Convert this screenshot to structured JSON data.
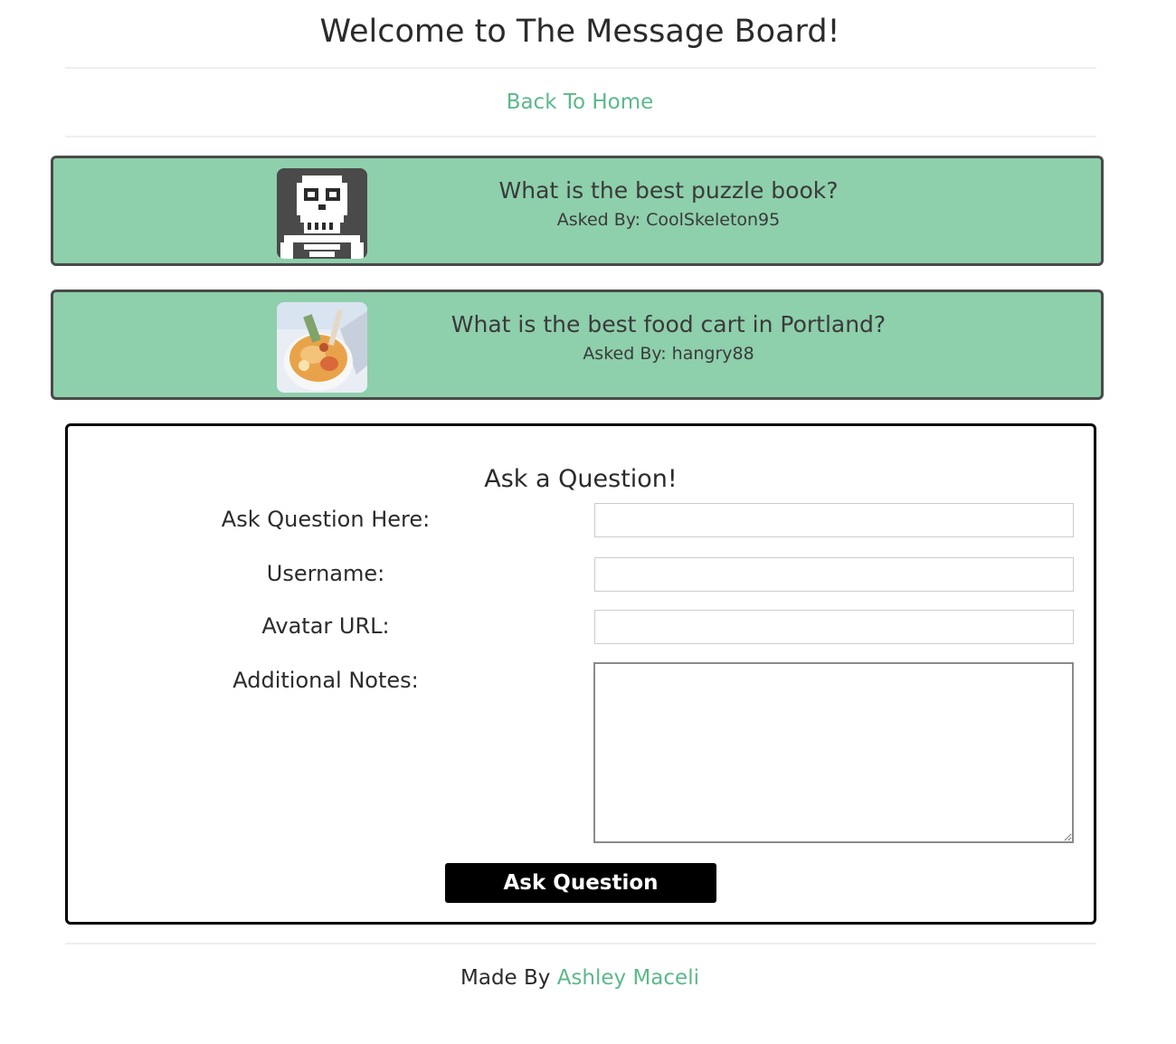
{
  "header": {
    "title": "Welcome to The Message Board!",
    "home_link": "Back To Home"
  },
  "questions": [
    {
      "title": "What is the best puzzle book?",
      "asked_by": "Asked By: CoolSkeleton95",
      "avatar_icon": "pixel-skeleton-icon"
    },
    {
      "title": "What is the best food cart in Portland?",
      "asked_by": "Asked By: hangry88",
      "avatar_icon": "ramen-bowl-icon"
    }
  ],
  "form": {
    "heading": "Ask a Question!",
    "question_label": "Ask Question Here:",
    "question_value": "",
    "username_label": "Username:",
    "username_value": "",
    "avatar_label": "Avatar URL:",
    "avatar_value": "",
    "notes_label": "Additional Notes:",
    "notes_value": "",
    "submit_label": "Ask Question"
  },
  "footer": {
    "prefix": "Made By",
    "author": "Ashley Maceli"
  },
  "colors": {
    "accent": "#5bb98a",
    "card_background": "#8ecfac",
    "card_border": "#4a4a4a",
    "button_background": "#000000"
  }
}
